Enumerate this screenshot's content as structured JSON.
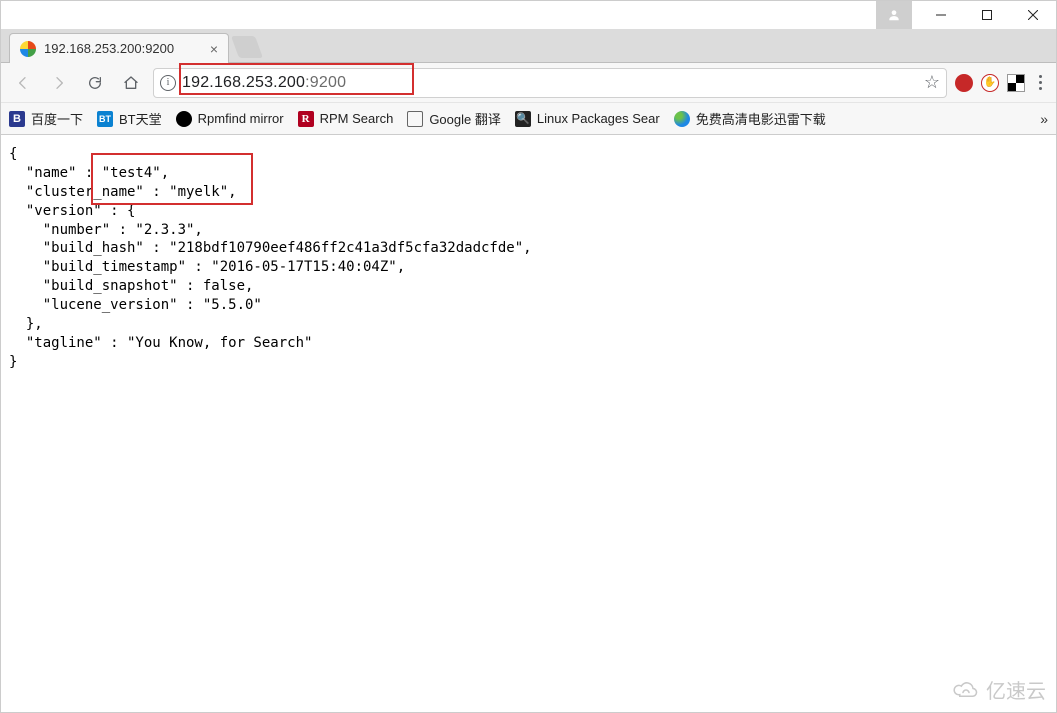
{
  "window": {
    "title": "192.168.253.200:9200"
  },
  "tab": {
    "title": "192.168.253.200:9200"
  },
  "address": {
    "host": "192.168.253.200",
    "port": ":9200"
  },
  "bookmarks": {
    "b1": "百度一下",
    "b2": "BT天堂",
    "b3": "Rpmfind mirror",
    "b4": "RPM Search",
    "b5": "Google 翻译",
    "b6": "Linux Packages Sear",
    "b7": "免费高清电影迅雷下载"
  },
  "json_body": {
    "line1": "{",
    "line2": "  \"name\" : \"test4\",",
    "line3": "  \"cluster_name\" : \"myelk\",",
    "line4": "  \"version\" : {",
    "line5": "    \"number\" : \"2.3.3\",",
    "line6": "    \"build_hash\" : \"218bdf10790eef486ff2c41a3df5cfa32dadcfde\",",
    "line7": "    \"build_timestamp\" : \"2016-05-17T15:40:04Z\",",
    "line8": "    \"build_snapshot\" : false,",
    "line9": "    \"lucene_version\" : \"5.5.0\"",
    "line10": "  },",
    "line11": "  \"tagline\" : \"You Know, for Search\"",
    "line12": "}"
  },
  "watermark": {
    "text": "亿速云"
  }
}
